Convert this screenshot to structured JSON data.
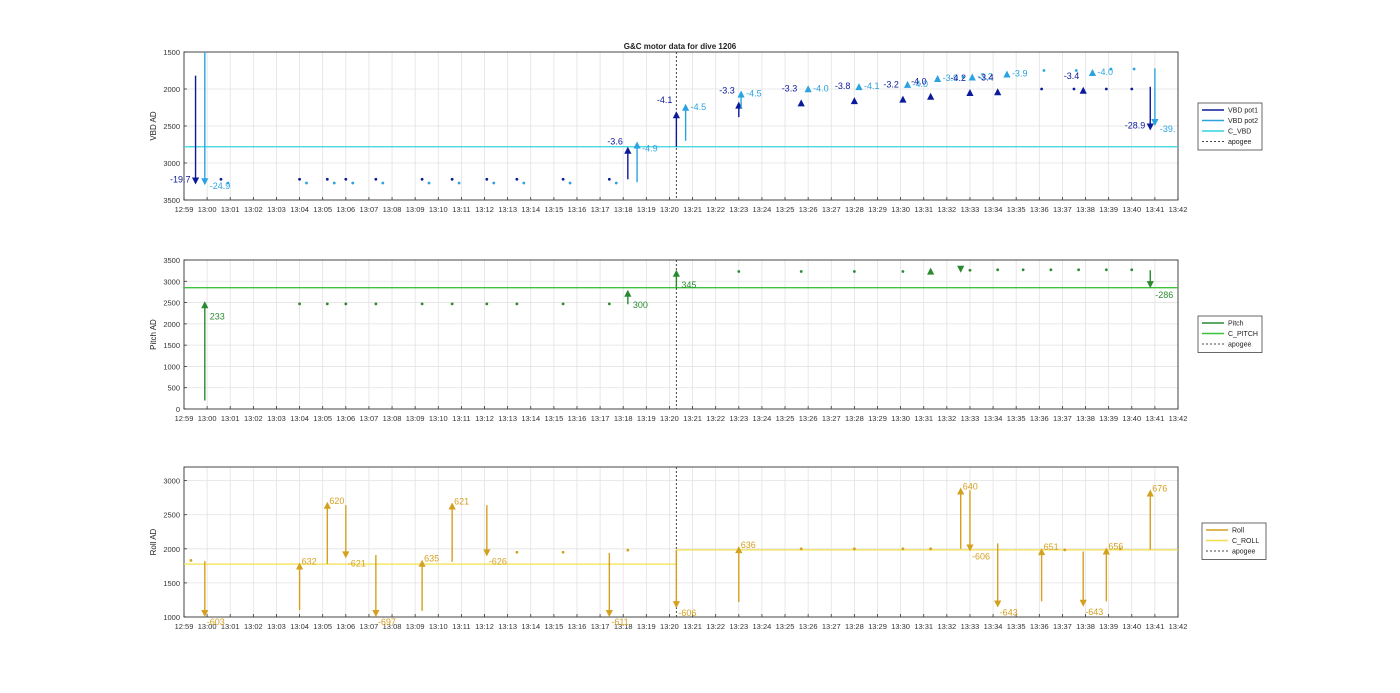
{
  "figure": {
    "title": "G&C motor data for dive 1206"
  },
  "colors": {
    "vbd_pot1": "#0b1a9a",
    "vbd_pot2": "#2aa3e0",
    "c_vbd": "#34d3e0",
    "pitch": "#2a8a32",
    "c_pitch": "#3cc23c",
    "roll": "#d4a020",
    "c_roll": "#f2e04a",
    "apogee": "#444444"
  },
  "time_ticks": [
    "12:59",
    "13:00",
    "13:01",
    "13:02",
    "13:03",
    "13:04",
    "13:05",
    "13:06",
    "13:07",
    "13:08",
    "13:09",
    "13:10",
    "13:11",
    "13:12",
    "13:13",
    "13:14",
    "13:15",
    "13:16",
    "13:17",
    "13:18",
    "13:19",
    "13:20",
    "13:21",
    "13:22",
    "13:23",
    "13:24",
    "13:25",
    "13:26",
    "13:27",
    "13:28",
    "13:29",
    "13:30",
    "13:31",
    "13:32",
    "13:33",
    "13:34",
    "13:35",
    "13:36",
    "13:37",
    "13:38",
    "13:39",
    "13:40",
    "13:41",
    "13:42"
  ],
  "chart_data": [
    {
      "type": "scatter",
      "title": "G&C motor data for dive 1206",
      "xlabel": "",
      "ylabel": "VBD AD",
      "y_reversed": true,
      "ylim": [
        1500,
        3500
      ],
      "y_ticks": [
        1500,
        2000,
        2500,
        3000,
        3500
      ],
      "grid": true,
      "legend_position": "right",
      "legend": [
        "VBD pot1",
        "VBD pot2",
        "C_VBD",
        "apogee"
      ],
      "apogee_time": 21.3,
      "reference_line": {
        "name": "C_VBD",
        "value": 2780
      },
      "series": [
        {
          "name": "VBD pot1",
          "points": [
            [
              1.6,
              3220
            ],
            [
              5.0,
              3220
            ],
            [
              6.2,
              3220
            ],
            [
              7.0,
              3220
            ],
            [
              8.3,
              3220
            ],
            [
              10.3,
              3220
            ],
            [
              11.6,
              3220
            ],
            [
              13.1,
              3220
            ],
            [
              14.4,
              3220
            ],
            [
              16.4,
              3220
            ],
            [
              18.4,
              3220
            ],
            [
              37.1,
              2000
            ],
            [
              38.5,
              2000
            ],
            [
              39.9,
              2000
            ],
            [
              41.0,
              2000
            ]
          ]
        },
        {
          "name": "VBD pot2",
          "points": [
            [
              1.9,
              3270
            ],
            [
              5.3,
              3270
            ],
            [
              6.5,
              3270
            ],
            [
              7.3,
              3270
            ],
            [
              8.6,
              3270
            ],
            [
              10.6,
              3270
            ],
            [
              11.9,
              3270
            ],
            [
              13.4,
              3270
            ],
            [
              14.7,
              3270
            ],
            [
              16.7,
              3270
            ],
            [
              18.7,
              3270
            ],
            [
              33.7,
              1840
            ],
            [
              37.2,
              1750
            ],
            [
              38.6,
              1750
            ],
            [
              40.1,
              1730
            ],
            [
              41.1,
              1730
            ]
          ]
        }
      ],
      "moves": [
        {
          "series": "VBD pot1",
          "t": 0.5,
          "from": 1820,
          "to": 3290,
          "label": "-19.7"
        },
        {
          "series": "VBD pot2",
          "t": 0.9,
          "from": 1500,
          "to": 3300,
          "label": "-24.9"
        },
        {
          "series": "VBD pot1",
          "t": 19.2,
          "from": 3220,
          "to": 2780,
          "label": "-3.6"
        },
        {
          "series": "VBD pot2",
          "t": 19.6,
          "from": 3260,
          "to": 2710,
          "label": "-4.9"
        },
        {
          "series": "VBD pot1",
          "t": 21.3,
          "from": 2780,
          "to": 2300,
          "label": "-4.1"
        },
        {
          "series": "VBD pot2",
          "t": 21.7,
          "from": 2700,
          "to": 2200,
          "label": "-4.5"
        },
        {
          "series": "VBD pot1",
          "t": 24.0,
          "from": 2380,
          "to": 2170,
          "label": "-3.3"
        },
        {
          "series": "VBD pot2",
          "t": 24.1,
          "from": 2260,
          "to": 2020,
          "label": "-4.5"
        },
        {
          "series": "VBD pot1",
          "t": 26.7,
          "from": 2180,
          "to": 2140,
          "label": "-3.3"
        },
        {
          "series": "VBD pot2",
          "t": 27.0,
          "from": 1990,
          "to": 1950,
          "label": "-4.0"
        },
        {
          "series": "VBD pot1",
          "t": 29.0,
          "from": 2150,
          "to": 2110,
          "label": "-3.8"
        },
        {
          "series": "VBD pot2",
          "t": 29.2,
          "from": 1960,
          "to": 1920,
          "label": "-4.1"
        },
        {
          "series": "VBD pot1",
          "t": 31.1,
          "from": 2130,
          "to": 2090,
          "label": "-3.2"
        },
        {
          "series": "VBD pot2",
          "t": 31.3,
          "from": 1930,
          "to": 1890,
          "label": "-4.0"
        },
        {
          "series": "VBD pot1",
          "t": 32.3,
          "from": 2090,
          "to": 2050,
          "label": "-4.0"
        },
        {
          "series": "VBD pot2",
          "t": 32.6,
          "from": 1850,
          "to": 1810,
          "label": "-3.9"
        },
        {
          "series": "VBD pot1",
          "t": 34.0,
          "from": 2040,
          "to": 2000,
          "label": "-4.2"
        },
        {
          "series": "VBD pot2",
          "t": 34.1,
          "from": 1830,
          "to": 1790,
          "label": "-3.2"
        },
        {
          "series": "VBD pot1",
          "t": 35.2,
          "from": 2030,
          "to": 1990,
          "label": "-3.4"
        },
        {
          "series": "VBD pot2",
          "t": 35.6,
          "from": 1790,
          "to": 1750,
          "label": "-3.9"
        },
        {
          "series": "VBD pot1",
          "t": 38.9,
          "from": 2010,
          "to": 1970,
          "label": "-3.4"
        },
        {
          "series": "VBD pot2",
          "t": 39.3,
          "from": 1770,
          "to": 1730,
          "label": "-4.0"
        },
        {
          "series": "VBD pot1",
          "t": 41.8,
          "from": 1970,
          "to": 2560,
          "label": "-28.9"
        },
        {
          "series": "VBD pot2",
          "t": 42.0,
          "from": 1720,
          "to": 2500,
          "label": "-39."
        }
      ]
    },
    {
      "type": "scatter",
      "title": "",
      "xlabel": "",
      "ylabel": "Pitch AD",
      "ylim": [
        0,
        3500
      ],
      "y_ticks": [
        0,
        500,
        1000,
        1500,
        2000,
        2500,
        3000,
        3500
      ],
      "grid": true,
      "legend_position": "right",
      "legend": [
        "Pitch",
        "C_PITCH",
        "apogee"
      ],
      "apogee_time": 21.3,
      "reference_line": {
        "name": "C_PITCH",
        "value": 2850
      },
      "series": [
        {
          "name": "Pitch",
          "points": [
            [
              5.0,
              2470
            ],
            [
              6.2,
              2470
            ],
            [
              7.0,
              2470
            ],
            [
              8.3,
              2470
            ],
            [
              10.3,
              2470
            ],
            [
              11.6,
              2470
            ],
            [
              13.1,
              2470
            ],
            [
              14.4,
              2470
            ],
            [
              16.4,
              2470
            ],
            [
              18.4,
              2470
            ],
            [
              24.0,
              3230
            ],
            [
              26.7,
              3230
            ],
            [
              29.0,
              3230
            ],
            [
              31.1,
              3230
            ],
            [
              34.0,
              3260
            ],
            [
              35.2,
              3270
            ],
            [
              36.3,
              3270
            ],
            [
              37.5,
              3270
            ],
            [
              38.7,
              3270
            ],
            [
              39.9,
              3270
            ],
            [
              41.0,
              3270
            ]
          ]
        }
      ],
      "moves": [
        {
          "series": "Pitch",
          "t": 0.9,
          "from": 200,
          "to": 2530,
          "label": "233"
        },
        {
          "series": "Pitch",
          "t": 19.2,
          "from": 2460,
          "to": 2800,
          "label": "300"
        },
        {
          "series": "Pitch",
          "t": 21.3,
          "from": 2850,
          "to": 3270,
          "label": "345"
        },
        {
          "series": "Pitch",
          "t": 32.3,
          "from": 3240,
          "to": 3320,
          "label": ""
        },
        {
          "series": "Pitch",
          "t": 33.6,
          "from": 3290,
          "to": 3200,
          "label": ""
        },
        {
          "series": "Pitch",
          "t": 41.8,
          "from": 3260,
          "to": 2840,
          "label": "-286"
        }
      ]
    },
    {
      "type": "scatter",
      "title": "",
      "xlabel": "",
      "ylabel": "Roll AD",
      "ylim": [
        1000,
        3200
      ],
      "y_ticks": [
        1000,
        1500,
        2000,
        2500,
        3000
      ],
      "grid": true,
      "legend_position": "right",
      "legend": [
        "Roll",
        "C_ROLL",
        "apogee"
      ],
      "apogee_time": 21.3,
      "reference_line_segments": [
        {
          "name": "C_ROLL",
          "t0": 0,
          "t1": 21.3,
          "value": 1775
        },
        {
          "name": "C_ROLL",
          "t0": 21.3,
          "t1": 43.0,
          "value": 1985
        }
      ],
      "series": [
        {
          "name": "Roll",
          "points": [
            [
              0.3,
              1830
            ],
            [
              14.4,
              1950
            ],
            [
              16.4,
              1950
            ],
            [
              19.2,
              1980
            ],
            [
              26.7,
              2000
            ],
            [
              29.0,
              2000
            ],
            [
              31.1,
              2000
            ],
            [
              32.3,
              2000
            ],
            [
              38.1,
              1985
            ],
            [
              40.5,
              2000
            ]
          ]
        }
      ],
      "moves": [
        {
          "series": "Roll",
          "t": 0.9,
          "from": 1820,
          "to": 1000,
          "label": "-603"
        },
        {
          "series": "Roll",
          "t": 5.0,
          "from": 1100,
          "to": 1800,
          "label": "632"
        },
        {
          "series": "Roll",
          "t": 6.2,
          "from": 1780,
          "to": 2690,
          "label": "620"
        },
        {
          "series": "Roll",
          "t": 7.0,
          "from": 2640,
          "to": 1860,
          "label": "-621"
        },
        {
          "series": "Roll",
          "t": 8.3,
          "from": 1910,
          "to": 1000,
          "label": "-697"
        },
        {
          "series": "Roll",
          "t": 10.3,
          "from": 1090,
          "to": 1840,
          "label": "635"
        },
        {
          "series": "Roll",
          "t": 11.6,
          "from": 1810,
          "to": 2680,
          "label": "621"
        },
        {
          "series": "Roll",
          "t": 13.1,
          "from": 2640,
          "to": 1890,
          "label": "-626"
        },
        {
          "series": "Roll",
          "t": 18.4,
          "from": 1940,
          "to": 1000,
          "label": "-611"
        },
        {
          "series": "Roll",
          "t": 21.3,
          "from": 1980,
          "to": 1130,
          "label": "-606"
        },
        {
          "series": "Roll",
          "t": 24.0,
          "from": 1220,
          "to": 2040,
          "label": "636"
        },
        {
          "series": "Roll",
          "t": 33.6,
          "from": 2000,
          "to": 2900,
          "label": "640"
        },
        {
          "series": "Roll",
          "t": 34.0,
          "from": 2860,
          "to": 1960,
          "label": "-606"
        },
        {
          "series": "Roll",
          "t": 35.2,
          "from": 2080,
          "to": 1140,
          "label": "-643"
        },
        {
          "series": "Roll",
          "t": 37.1,
          "from": 1230,
          "to": 2010,
          "label": "651"
        },
        {
          "series": "Roll",
          "t": 38.9,
          "from": 1960,
          "to": 1150,
          "label": "-643"
        },
        {
          "series": "Roll",
          "t": 39.9,
          "from": 1230,
          "to": 2020,
          "label": "656"
        },
        {
          "series": "Roll",
          "t": 41.8,
          "from": 1990,
          "to": 2870,
          "label": "676"
        }
      ]
    }
  ]
}
